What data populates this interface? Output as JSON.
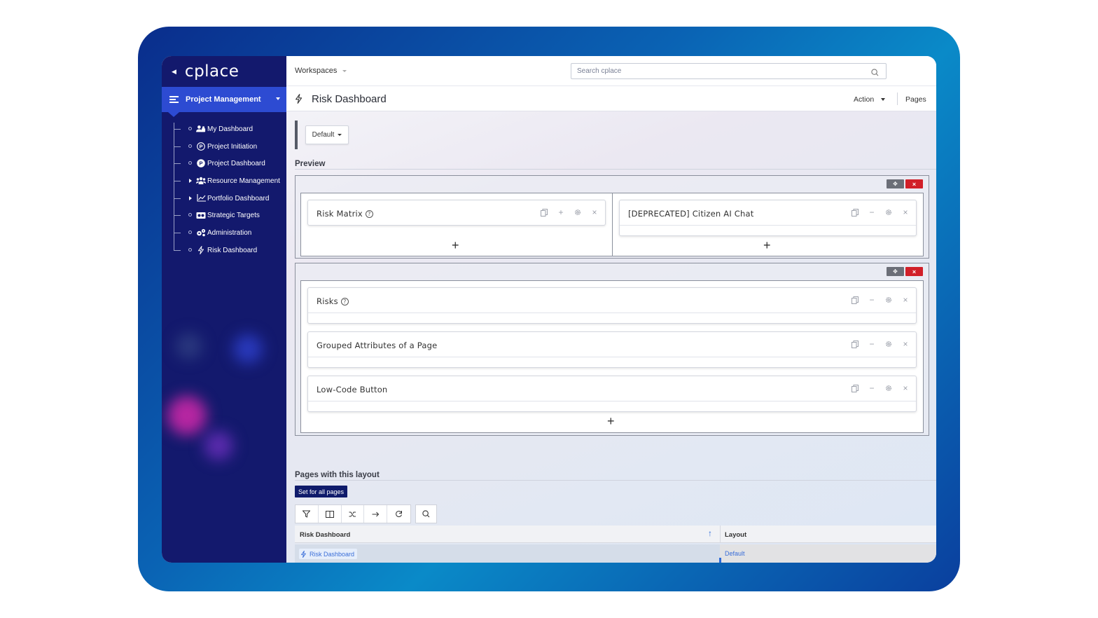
{
  "sidebar": {
    "brand": "cplace",
    "workspace_label": "Project Management",
    "items": [
      {
        "label": "My Dashboard",
        "icon": "users-icon",
        "expandable": false
      },
      {
        "label": "Project Initiation",
        "icon": "p-outline-icon",
        "expandable": false
      },
      {
        "label": "Project Dashboard",
        "icon": "p-filled-icon",
        "expandable": false
      },
      {
        "label": "Resource Management",
        "icon": "team-icon",
        "expandable": true
      },
      {
        "label": "Portfolio Dashboard",
        "icon": "chart-line-icon",
        "expandable": true
      },
      {
        "label": "Strategic Targets",
        "icon": "target-icon",
        "expandable": false
      },
      {
        "label": "Administration",
        "icon": "gears-icon",
        "expandable": false
      },
      {
        "label": "Risk Dashboard",
        "icon": "bolt-icon",
        "expandable": false
      }
    ]
  },
  "topbar": {
    "workspaces_label": "Workspaces",
    "search_placeholder": "Search cplace"
  },
  "titlebar": {
    "title": "Risk Dashboard",
    "action_label": "Action",
    "pages_label": "Pages"
  },
  "layout_selector": {
    "value": "Default"
  },
  "preview": {
    "title": "Preview",
    "row1": {
      "left_widget": {
        "title": "Risk Matrix",
        "help": true
      },
      "right_widget": {
        "title": "[DEPRECATED] Citizen AI Chat",
        "help": false
      }
    },
    "row2": {
      "widgets": [
        {
          "title": "Risks",
          "help": true
        },
        {
          "title": "Grouped Attributes of a Page",
          "help": false
        },
        {
          "title": "Low-Code Button",
          "help": false
        }
      ]
    }
  },
  "pages_section": {
    "title": "Pages with this layout",
    "set_all_label": "Set for all pages",
    "toolbar_icons": [
      "filter-icon",
      "columns-icon",
      "shuffle-icon",
      "arrow-right-icon",
      "refresh-icon",
      "search-icon"
    ],
    "table": {
      "columns": [
        "Risk Dashboard",
        "Layout"
      ],
      "rows": [
        {
          "page": "Risk Dashboard",
          "layout": "Default"
        }
      ]
    }
  },
  "colors": {
    "sidebar_bg": "#13196d",
    "workspace_bar": "#2d4bd2",
    "danger": "#d11f28",
    "link": "#3a6ed8"
  }
}
